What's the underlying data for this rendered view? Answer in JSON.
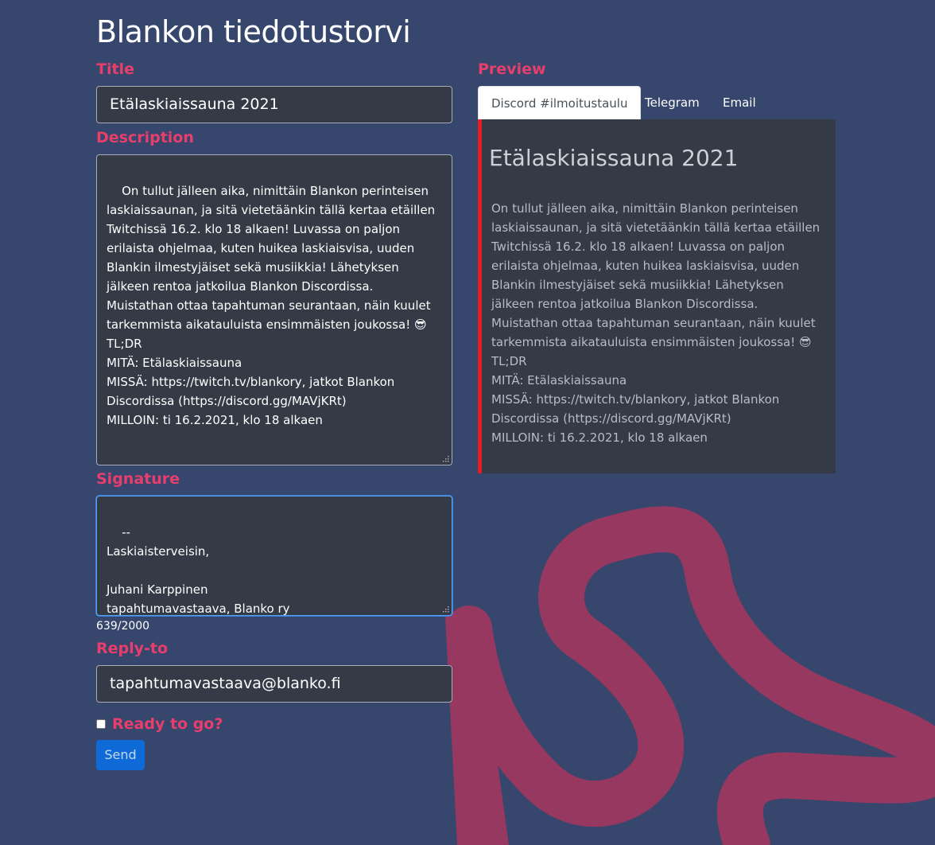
{
  "app": {
    "title": "Blankon tiedotustorvi"
  },
  "form": {
    "title_label": "Title",
    "title_value": "Etälaskiaissauna 2021",
    "description_label": "Description",
    "description_value": "On tullut jälleen aika, nimittäin Blankon perinteisen laskiaissaunan, ja sitä vietetäänkin tällä kertaa etäillen Twitchissä 16.2. klo 18 alkaen! Luvassa on paljon erilaista ohjelmaa, kuten huikea laskiaisvisa, uuden Blankin ilmestyjäiset sekä musiikkia! Lähetyksen jälkeen rentoa jatkoilua Blankon Discordissa.\nMuistathan ottaa tapahtuman seurantaan, näin kuulet tarkemmista aikatauluista ensimmäisten joukossa! 😎\nTL;DR\nMITÄ: Etälaskiaissauna\nMISSÄ: https://twitch.tv/blankory, jatkot Blankon Discordissa (https://discord.gg/MAVjKRt)\nMILLOIN: ti 16.2.2021, klo 18 alkaen",
    "signature_label": "Signature",
    "signature_value": "--\nLaskiaisterveisin,\n\nJuhani Karppinen\ntapahtumavastaava, Blanko ry",
    "char_count": "639/2000",
    "reply_to_label": "Reply-to",
    "reply_to_value": "tapahtumavastaava@blanko.fi",
    "ready_label": "Ready to go?",
    "send_label": "Send"
  },
  "preview": {
    "label": "Preview",
    "tabs": [
      {
        "label": "Discord #ilmoitustaulu",
        "active": true
      },
      {
        "label": "Telegram",
        "active": false
      },
      {
        "label": "Email",
        "active": false
      }
    ],
    "title": "Etälaskiaissauna 2021",
    "body": "On tullut jälleen aika, nimittäin Blankon perinteisen laskiaissaunan, ja sitä vietetäänkin tällä kertaa etäillen Twitchissä 16.2. klo 18 alkaen! Luvassa on paljon erilaista ohjelmaa, kuten huikea laskiaisvisa, uuden Blankin ilmestyjäiset sekä musiikkia! Lähetyksen jälkeen rentoa jatkoilua Blankon Discordissa.\nMuistathan ottaa tapahtuman seurantaan, näin kuulet tarkemmista aikatauluista ensimmäisten joukossa! 😎\nTL;DR\nMITÄ: Etälaskiaissauna\nMISSÄ: https://twitch.tv/blankory, jatkot Blankon Discordissa (https://discord.gg/MAVjKRt)\nMILLOIN: ti 16.2.2021, klo 18 alkaen"
  },
  "colors": {
    "background": "#36466d",
    "accent_label": "#e83e6c",
    "field_bg": "#343a46",
    "discord_bar": "#e51e25",
    "send_button": "#0d6ad6",
    "logo": "#96385f"
  },
  "icons": {
    "resize_grip": "resize-grip-icon",
    "background_logo": "blanko-logo-icon"
  }
}
